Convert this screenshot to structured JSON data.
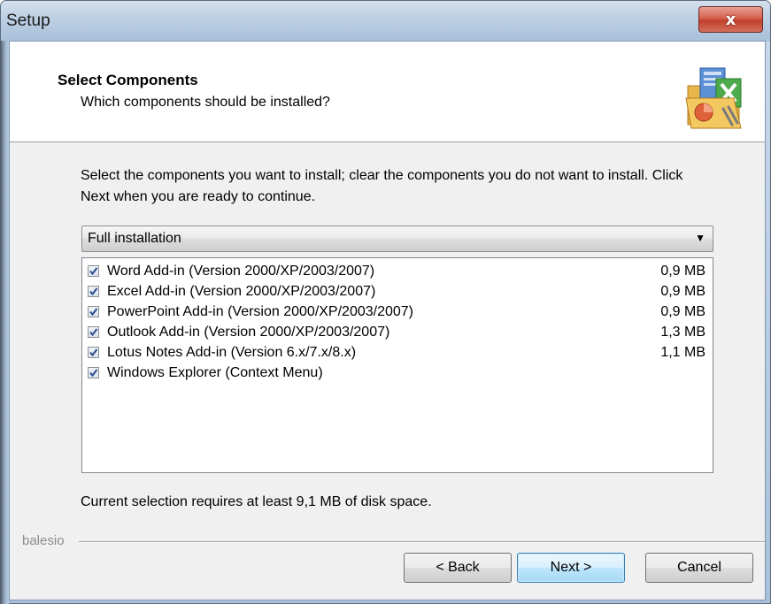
{
  "window": {
    "title": "Setup",
    "close_label": "x"
  },
  "header": {
    "title": "Select Components",
    "subtitle": "Which components should be installed?",
    "logo_icon": "office-setup-icon"
  },
  "instructions": "Select the components you want to install; clear the components you do not want to install. Click Next when you are ready to continue.",
  "install_type": {
    "selected": "Full installation"
  },
  "components": [
    {
      "label": "Word Add-in (Version 2000/XP/2003/2007)",
      "size": "0,9 MB",
      "checked": true
    },
    {
      "label": "Excel Add-in (Version 2000/XP/2003/2007)",
      "size": "0,9 MB",
      "checked": true
    },
    {
      "label": "PowerPoint Add-in (Version 2000/XP/2003/2007)",
      "size": "0,9 MB",
      "checked": true
    },
    {
      "label": "Outlook Add-in (Version 2000/XP/2003/2007)",
      "size": "1,3 MB",
      "checked": true
    },
    {
      "label": "Lotus Notes Add-in (Version 6.x/7.x/8.x)",
      "size": "1,1 MB",
      "checked": true
    },
    {
      "label": "Windows Explorer (Context Menu)",
      "size": "",
      "checked": true
    }
  ],
  "disk_space_text": "Current selection requires at least 9,1 MB of disk space.",
  "brand": "balesio",
  "buttons": {
    "back": "< Back",
    "next": "Next >",
    "cancel": "Cancel"
  },
  "colors": {
    "accent_button_border": "#3c7fb1",
    "close_button": "#c7432f",
    "checkmark": "#2b4a8a"
  }
}
